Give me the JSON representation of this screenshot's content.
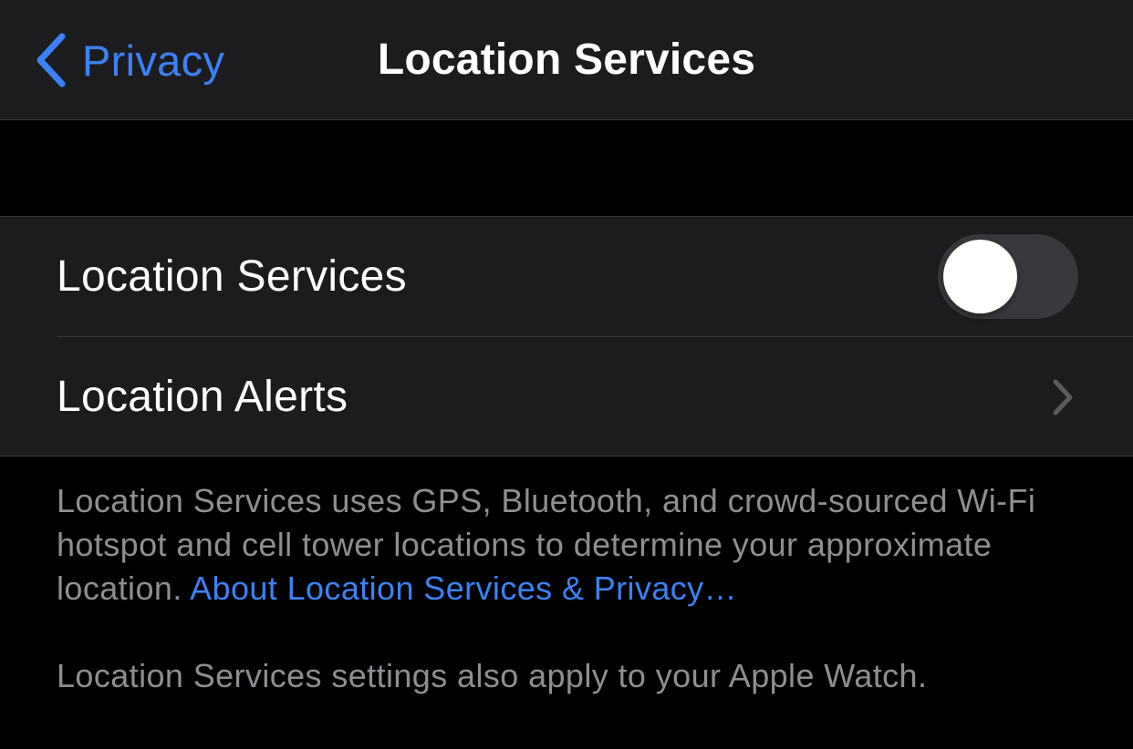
{
  "nav": {
    "back_label": "Privacy",
    "title": "Location Services"
  },
  "settings": {
    "location_services": {
      "label": "Location Services",
      "toggle_on": false
    },
    "location_alerts": {
      "label": "Location Alerts"
    }
  },
  "footer": {
    "description": "Location Services uses GPS, Bluetooth, and crowd-sourced Wi-Fi hotspot and cell tower locations to determine your approximate location.",
    "link_text": "About Location Services & Privacy…",
    "note": "Location Services settings also apply to your Apple Watch."
  },
  "colors": {
    "accent": "#3b82f6",
    "background": "#000000",
    "cell_background": "#1c1c1e",
    "secondary_text": "#8e8e93"
  },
  "icons": {
    "back": "chevron-left-icon",
    "disclosure": "chevron-right-icon"
  }
}
